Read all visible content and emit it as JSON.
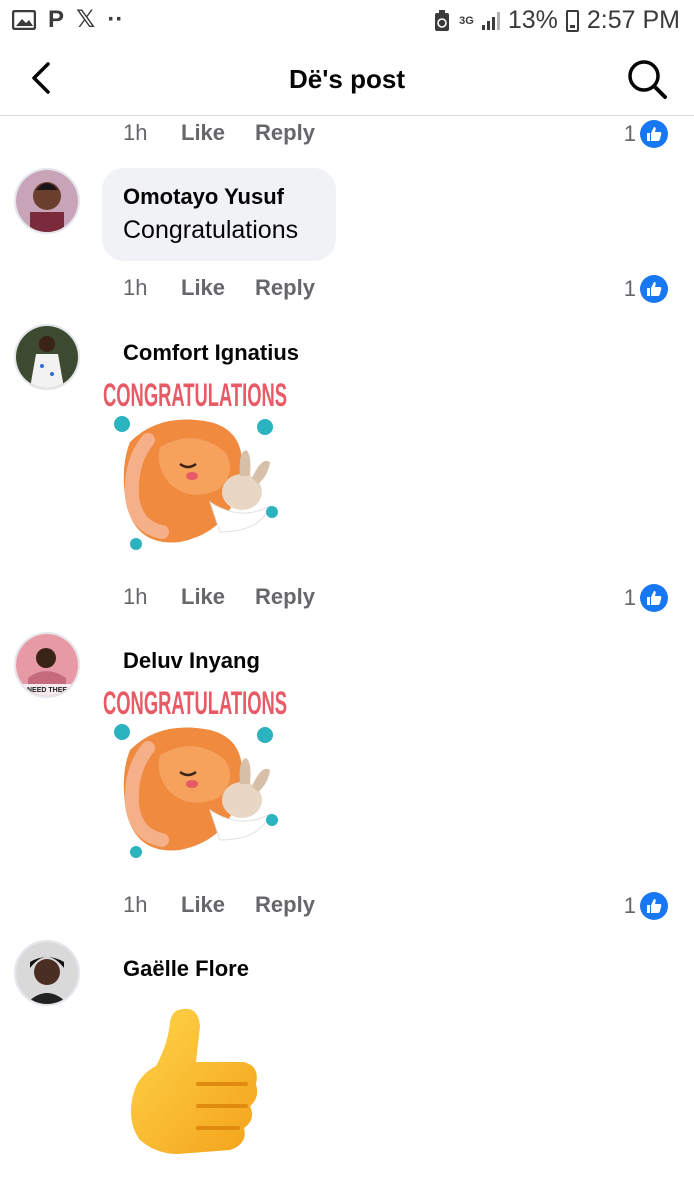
{
  "status_bar": {
    "notification_icons": [
      "image-icon",
      "p-icon",
      "x-icon",
      "more-dots-icon"
    ],
    "p_letter": "P",
    "x_letter": "𝕏",
    "dots": "··",
    "network": "3G",
    "battery": "13%",
    "time": "2:57 PM"
  },
  "header": {
    "title": "Dë's post"
  },
  "actions": {
    "like": "Like",
    "reply": "Reply"
  },
  "comments": [
    {
      "author": "",
      "text": "",
      "time": "1h",
      "like_count": "1"
    },
    {
      "author": "Omotayo Yusuf",
      "text": "Congratulations",
      "time": "1h",
      "like_count": "1"
    },
    {
      "author": "Comfort Ignatius",
      "sticker_text": "CONGRATULATIONS",
      "time": "1h",
      "like_count": "1"
    },
    {
      "author": "Deluv Inyang",
      "sticker_text": "CONGRATULATIONS",
      "avatar_text": "NEED THEE",
      "time": "1h",
      "like_count": "1"
    },
    {
      "author": "Gaëlle Flore",
      "reaction": "thumbs-up"
    }
  ],
  "colors": {
    "accent": "#1877f2",
    "sticker_text": "#e85a66",
    "sticker_orange": "#ef8a3e",
    "sticker_teal": "#2bb3c0"
  }
}
